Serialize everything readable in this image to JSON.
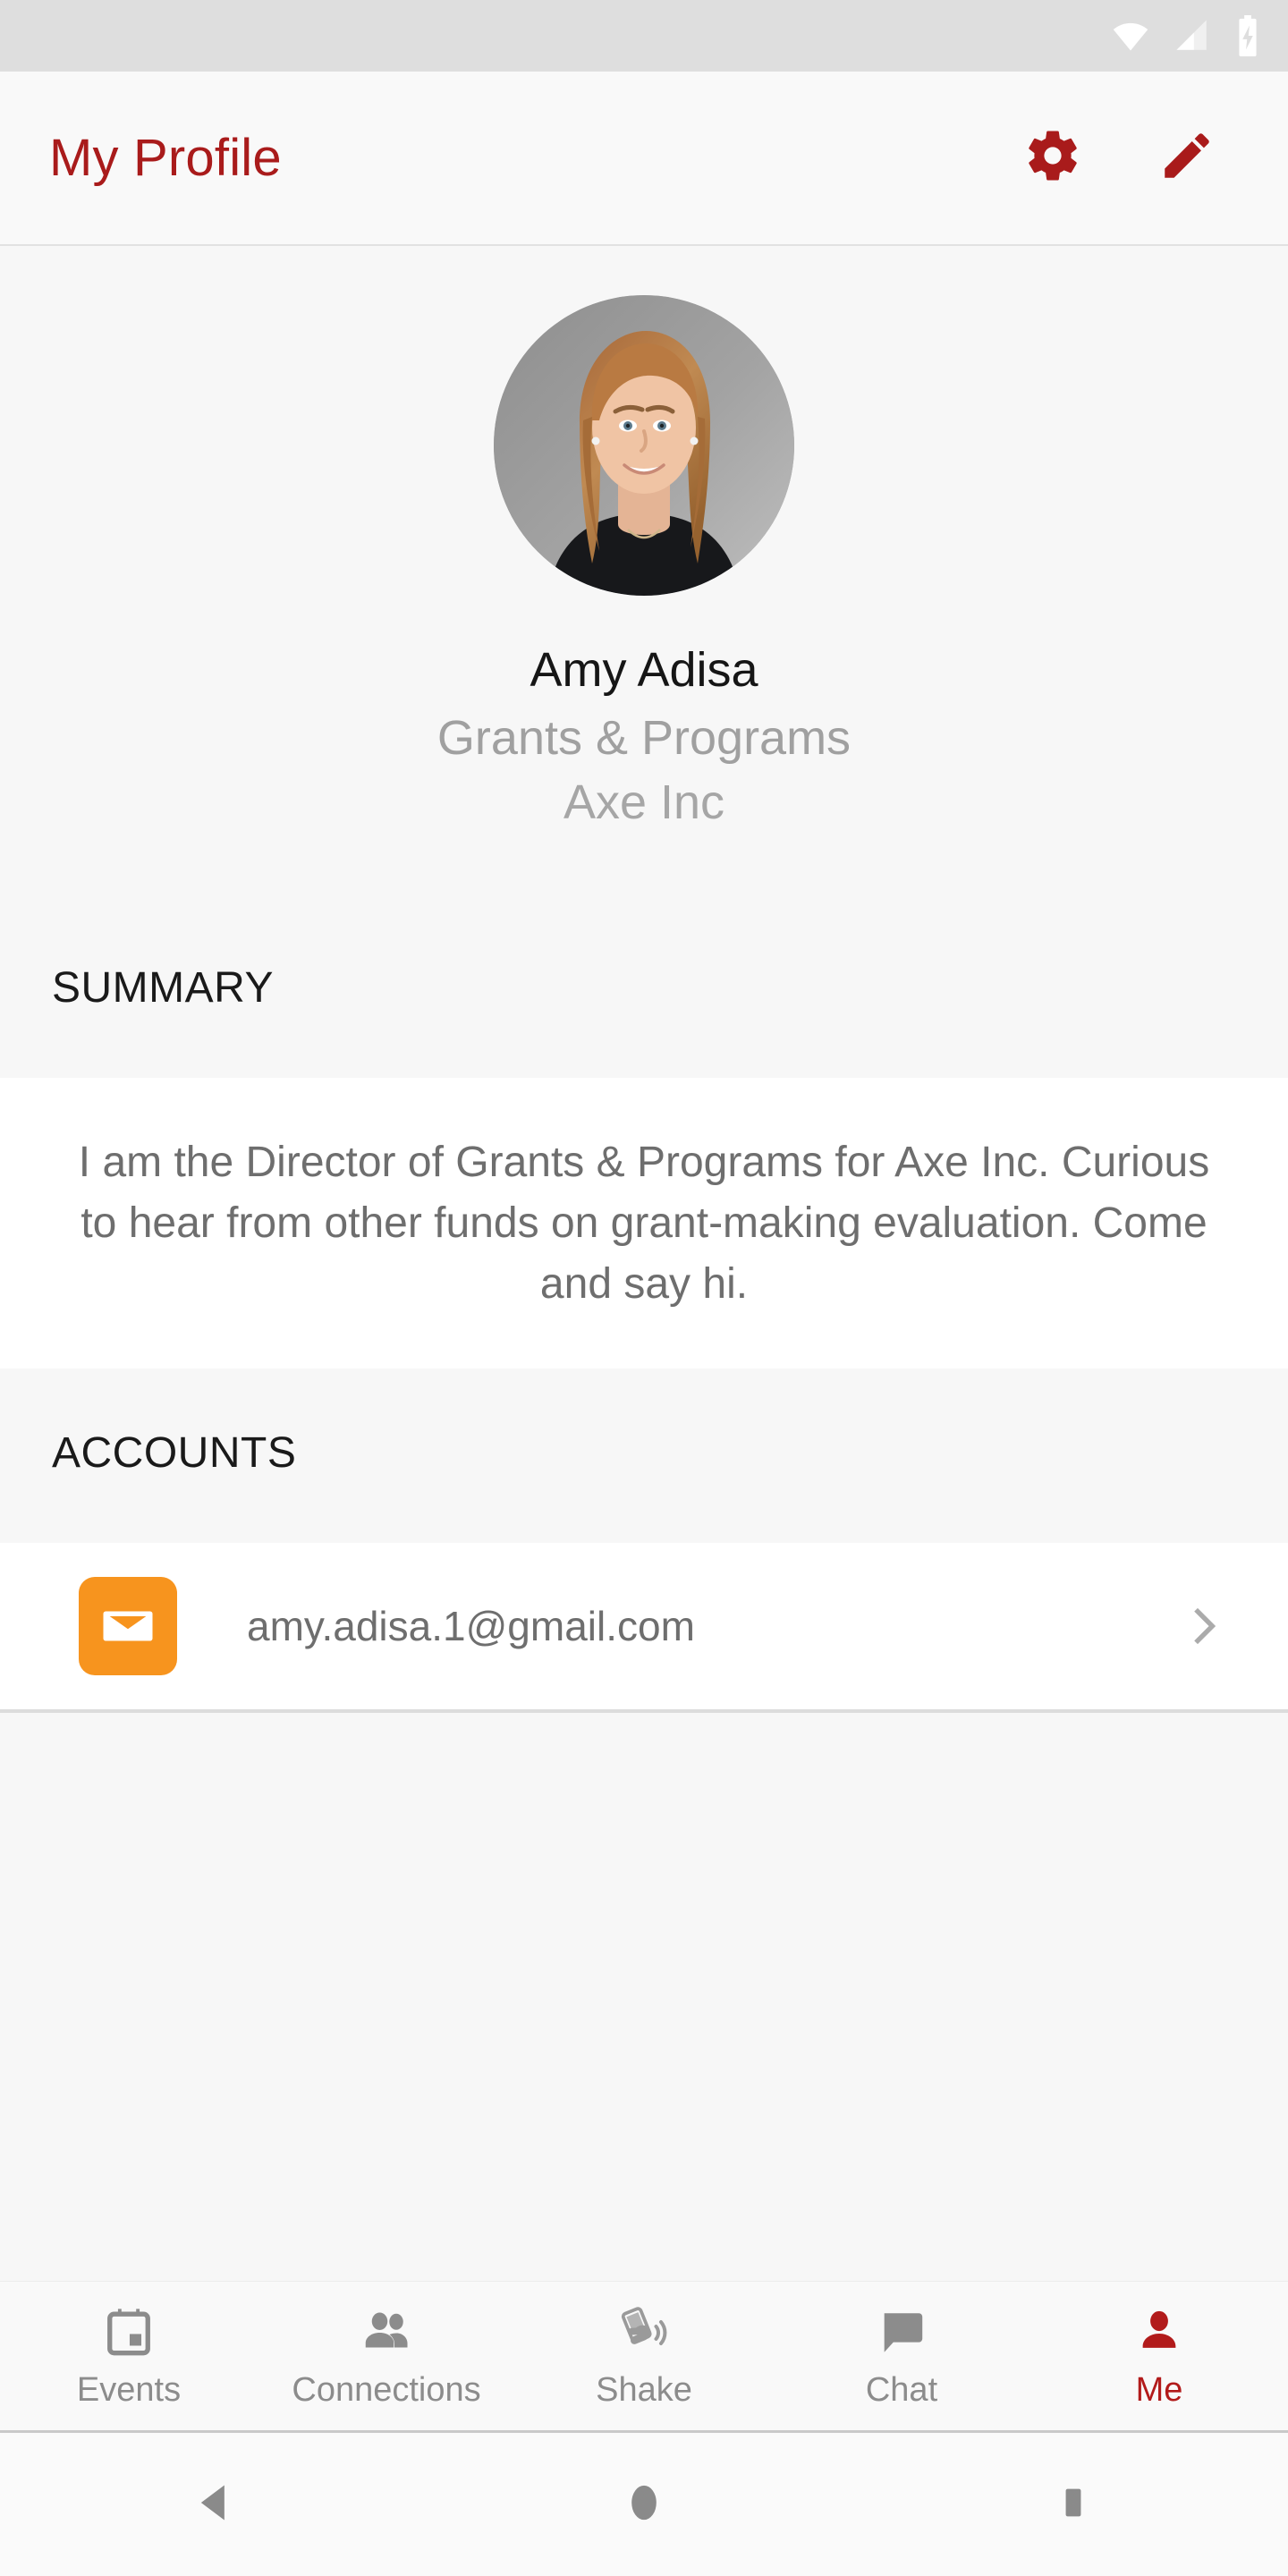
{
  "statusbar": {
    "icons": [
      "wifi-icon",
      "cellular-signal-icon",
      "battery-charging-icon"
    ]
  },
  "appbar": {
    "title": "My Profile",
    "accent_color": "#A91B1B",
    "actions": [
      {
        "name": "settings-button",
        "icon": "gear-icon"
      },
      {
        "name": "edit-profile-button",
        "icon": "pencil-icon"
      }
    ]
  },
  "profile": {
    "avatar_alt": "profile-photo",
    "name": "Amy Adisa",
    "role": "Grants & Programs",
    "organization": "Axe Inc"
  },
  "summary": {
    "header": "SUMMARY",
    "body": "I am the Director of Grants & Programs for Axe Inc. Curious to hear from other funds on grant-making evaluation. Come and say hi."
  },
  "accounts": {
    "header": "ACCOUNTS",
    "items": [
      {
        "icon": "email-icon",
        "icon_color": "#F7941E",
        "value": "amy.adisa.1@gmail.com",
        "chevron": "chevron-right-icon"
      }
    ]
  },
  "tabbar": {
    "active_color": "#B21B1B",
    "inactive_color": "#8C8C8C",
    "tabs": [
      {
        "label": "Events",
        "icon": "calendar-icon",
        "active": false
      },
      {
        "label": "Connections",
        "icon": "people-icon",
        "active": false
      },
      {
        "label": "Shake",
        "icon": "shake-phone-icon",
        "active": false
      },
      {
        "label": "Chat",
        "icon": "chat-bubble-icon",
        "active": false
      },
      {
        "label": "Me",
        "icon": "person-icon",
        "active": true
      }
    ]
  },
  "sysnav": {
    "buttons": [
      {
        "name": "back-button",
        "icon": "triangle-back-icon"
      },
      {
        "name": "home-button",
        "icon": "circle-home-icon"
      },
      {
        "name": "recents-button",
        "icon": "square-recents-icon"
      }
    ]
  }
}
